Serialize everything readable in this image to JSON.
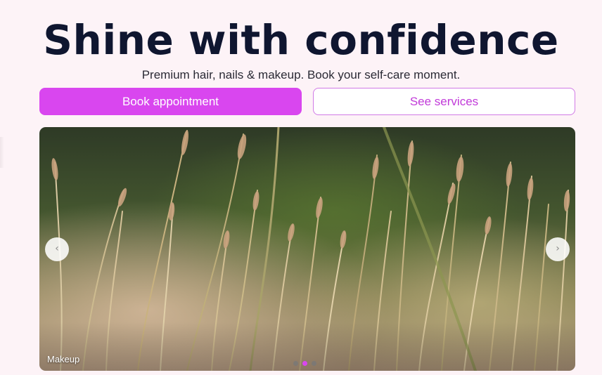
{
  "hero": {
    "title": "Shine with confidence",
    "subtitle": "Premium hair, nails & makeup. Book your self-care moment."
  },
  "actions": {
    "book_label": "Book appointment",
    "services_label": "See services"
  },
  "carousel": {
    "prev_icon": "‹",
    "next_icon": "›",
    "caption": "Makeup",
    "slide_count": 3,
    "active_slide": 2
  },
  "colors": {
    "accent": "#d946ef",
    "page_bg": "#fdf3f7",
    "heading": "#0f1630"
  }
}
